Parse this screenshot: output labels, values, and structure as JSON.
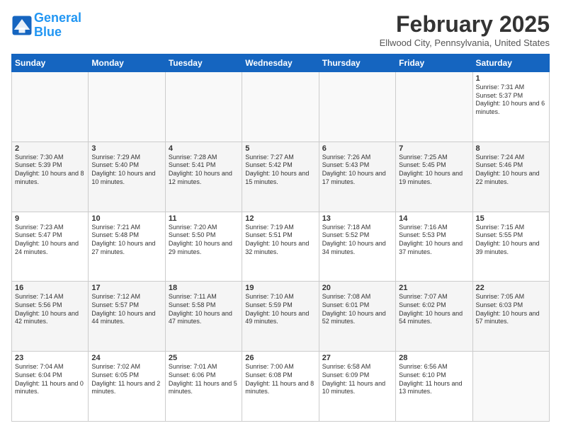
{
  "logo": {
    "line1": "General",
    "line2": "Blue"
  },
  "title": "February 2025",
  "location": "Ellwood City, Pennsylvania, United States",
  "days_of_week": [
    "Sunday",
    "Monday",
    "Tuesday",
    "Wednesday",
    "Thursday",
    "Friday",
    "Saturday"
  ],
  "weeks": [
    [
      {
        "day": "",
        "info": ""
      },
      {
        "day": "",
        "info": ""
      },
      {
        "day": "",
        "info": ""
      },
      {
        "day": "",
        "info": ""
      },
      {
        "day": "",
        "info": ""
      },
      {
        "day": "",
        "info": ""
      },
      {
        "day": "1",
        "info": "Sunrise: 7:31 AM\nSunset: 5:37 PM\nDaylight: 10 hours and 6 minutes."
      }
    ],
    [
      {
        "day": "2",
        "info": "Sunrise: 7:30 AM\nSunset: 5:39 PM\nDaylight: 10 hours and 8 minutes."
      },
      {
        "day": "3",
        "info": "Sunrise: 7:29 AM\nSunset: 5:40 PM\nDaylight: 10 hours and 10 minutes."
      },
      {
        "day": "4",
        "info": "Sunrise: 7:28 AM\nSunset: 5:41 PM\nDaylight: 10 hours and 12 minutes."
      },
      {
        "day": "5",
        "info": "Sunrise: 7:27 AM\nSunset: 5:42 PM\nDaylight: 10 hours and 15 minutes."
      },
      {
        "day": "6",
        "info": "Sunrise: 7:26 AM\nSunset: 5:43 PM\nDaylight: 10 hours and 17 minutes."
      },
      {
        "day": "7",
        "info": "Sunrise: 7:25 AM\nSunset: 5:45 PM\nDaylight: 10 hours and 19 minutes."
      },
      {
        "day": "8",
        "info": "Sunrise: 7:24 AM\nSunset: 5:46 PM\nDaylight: 10 hours and 22 minutes."
      }
    ],
    [
      {
        "day": "9",
        "info": "Sunrise: 7:23 AM\nSunset: 5:47 PM\nDaylight: 10 hours and 24 minutes."
      },
      {
        "day": "10",
        "info": "Sunrise: 7:21 AM\nSunset: 5:48 PM\nDaylight: 10 hours and 27 minutes."
      },
      {
        "day": "11",
        "info": "Sunrise: 7:20 AM\nSunset: 5:50 PM\nDaylight: 10 hours and 29 minutes."
      },
      {
        "day": "12",
        "info": "Sunrise: 7:19 AM\nSunset: 5:51 PM\nDaylight: 10 hours and 32 minutes."
      },
      {
        "day": "13",
        "info": "Sunrise: 7:18 AM\nSunset: 5:52 PM\nDaylight: 10 hours and 34 minutes."
      },
      {
        "day": "14",
        "info": "Sunrise: 7:16 AM\nSunset: 5:53 PM\nDaylight: 10 hours and 37 minutes."
      },
      {
        "day": "15",
        "info": "Sunrise: 7:15 AM\nSunset: 5:55 PM\nDaylight: 10 hours and 39 minutes."
      }
    ],
    [
      {
        "day": "16",
        "info": "Sunrise: 7:14 AM\nSunset: 5:56 PM\nDaylight: 10 hours and 42 minutes."
      },
      {
        "day": "17",
        "info": "Sunrise: 7:12 AM\nSunset: 5:57 PM\nDaylight: 10 hours and 44 minutes."
      },
      {
        "day": "18",
        "info": "Sunrise: 7:11 AM\nSunset: 5:58 PM\nDaylight: 10 hours and 47 minutes."
      },
      {
        "day": "19",
        "info": "Sunrise: 7:10 AM\nSunset: 5:59 PM\nDaylight: 10 hours and 49 minutes."
      },
      {
        "day": "20",
        "info": "Sunrise: 7:08 AM\nSunset: 6:01 PM\nDaylight: 10 hours and 52 minutes."
      },
      {
        "day": "21",
        "info": "Sunrise: 7:07 AM\nSunset: 6:02 PM\nDaylight: 10 hours and 54 minutes."
      },
      {
        "day": "22",
        "info": "Sunrise: 7:05 AM\nSunset: 6:03 PM\nDaylight: 10 hours and 57 minutes."
      }
    ],
    [
      {
        "day": "23",
        "info": "Sunrise: 7:04 AM\nSunset: 6:04 PM\nDaylight: 11 hours and 0 minutes."
      },
      {
        "day": "24",
        "info": "Sunrise: 7:02 AM\nSunset: 6:05 PM\nDaylight: 11 hours and 2 minutes."
      },
      {
        "day": "25",
        "info": "Sunrise: 7:01 AM\nSunset: 6:06 PM\nDaylight: 11 hours and 5 minutes."
      },
      {
        "day": "26",
        "info": "Sunrise: 7:00 AM\nSunset: 6:08 PM\nDaylight: 11 hours and 8 minutes."
      },
      {
        "day": "27",
        "info": "Sunrise: 6:58 AM\nSunset: 6:09 PM\nDaylight: 11 hours and 10 minutes."
      },
      {
        "day": "28",
        "info": "Sunrise: 6:56 AM\nSunset: 6:10 PM\nDaylight: 11 hours and 13 minutes."
      },
      {
        "day": "",
        "info": ""
      }
    ]
  ]
}
